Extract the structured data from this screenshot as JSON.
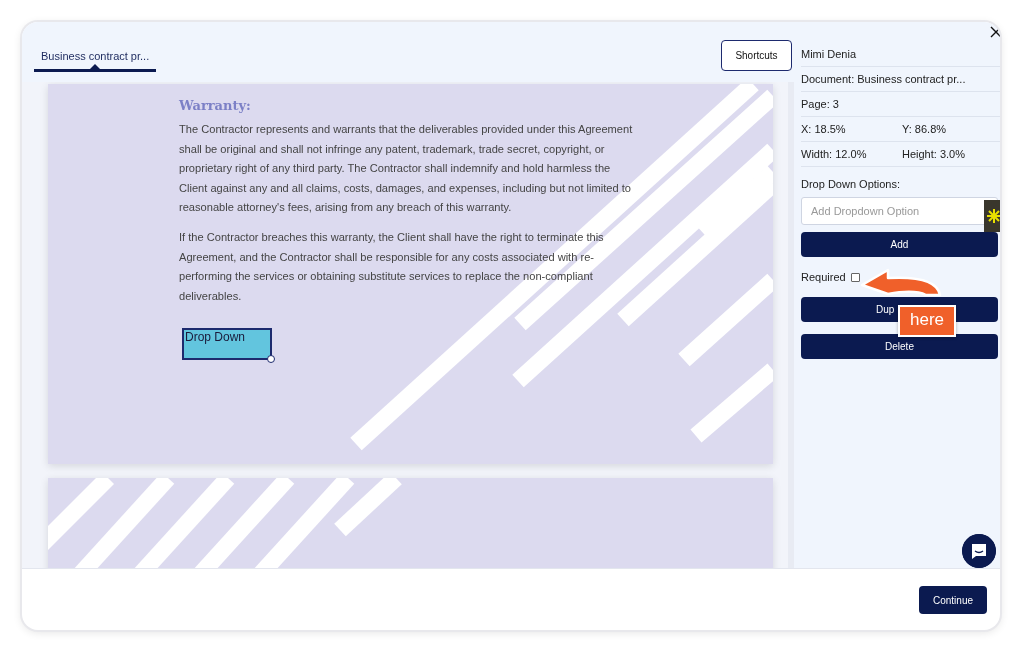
{
  "tab": {
    "label": "Business contract pr...",
    "selected": true
  },
  "shortcuts_button": "Shortcuts",
  "document": {
    "heading": "Warranty:",
    "paragraphs": [
      "The Contractor represents and warrants that the deliverables provided under this Agreement shall be original and shall not infringe any patent, trademark, trade secret, copyright, or proprietary right of any third party. The Contractor shall indemnify and hold harmless the Client against any and all claims, costs, damages, and expenses, including but not limited to reasonable attorney's fees, arising from any breach of this warranty.",
      "If the Contractor breaches this warranty, the Client shall have the right to terminate this Agreement, and the Contractor shall be responsible for any costs associated with re-performing the services or obtaining substitute services to replace the non-compliant deliverables."
    ],
    "field": {
      "label": "Drop Down",
      "selected": true
    }
  },
  "panel": {
    "user": "Mimi Denia",
    "document": "Document: Business contract pr...",
    "page": "Page: 3",
    "x": "X: 18.5%",
    "y": "Y: 86.8%",
    "width": "Width: 12.0%",
    "height": "Height: 3.0%",
    "options_label": "Drop Down Options:",
    "option_input": {
      "placeholder": "Add Dropdown Option"
    },
    "add_button": "Add",
    "required": {
      "label": "Required",
      "checked": false
    },
    "buttons": [
      "Dup",
      "Delete"
    ]
  },
  "callout": "here",
  "continue_button": "Continue"
}
